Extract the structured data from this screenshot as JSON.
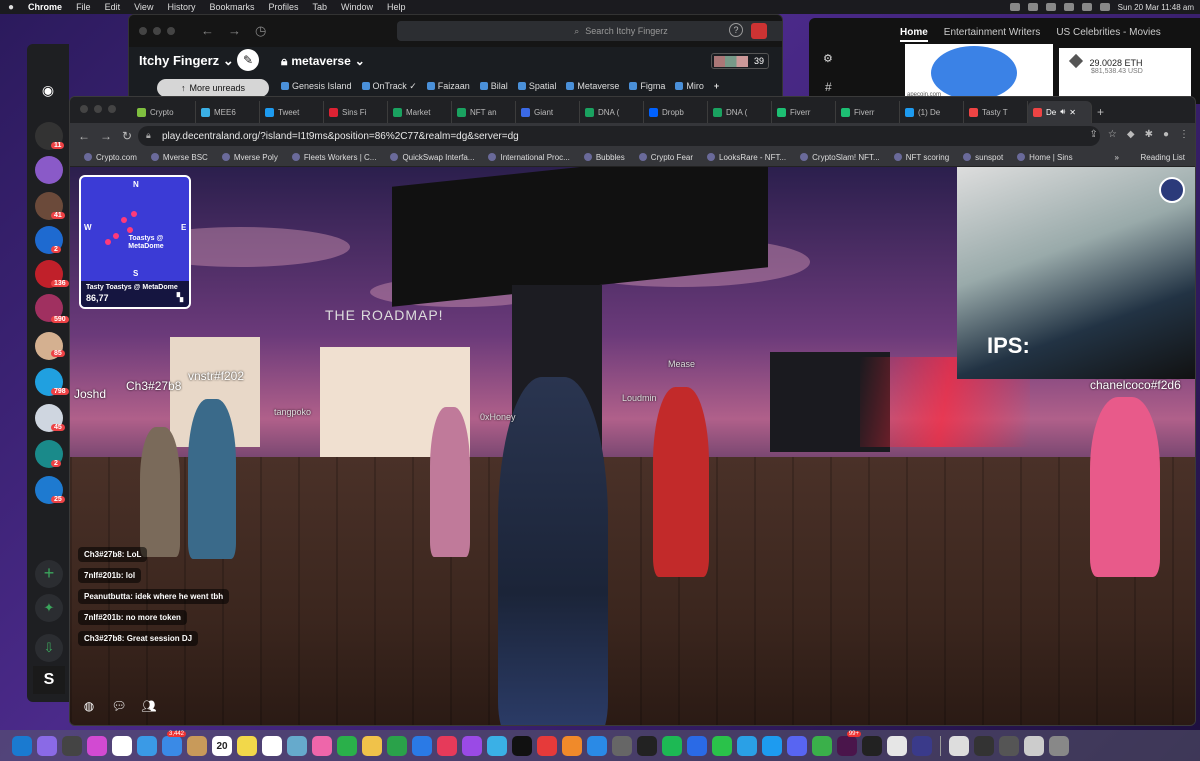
{
  "menubar": {
    "apple": "",
    "app_name": "Chrome",
    "menus": [
      "File",
      "Edit",
      "View",
      "History",
      "Bookmarks",
      "Profiles",
      "Tab",
      "Window",
      "Help"
    ],
    "clock": "Sun 20 Mar  11:48 am"
  },
  "slack": {
    "search_placeholder": "Search Itchy Fingerz",
    "help": "?",
    "workspace": "Itchy Fingerz",
    "workspace_chevron": "⌄",
    "more_unreads": "More unreads",
    "channel": "metaverse",
    "channel_suffix": "⌄",
    "member_count": "39",
    "bookmarks": [
      "Genesis Island",
      "OnTrack ✓",
      "Faizaan",
      "Bilal",
      "Spatial",
      "Metaverse",
      "Figma",
      "Miro"
    ],
    "bookmark_add": "+"
  },
  "side_window": {
    "tabs": [
      "Home",
      "Entertainment Writers",
      "US Celebrities - Movies"
    ],
    "site_label": "apecoin.com",
    "eth_amount": "29.0028 ETH",
    "usd_amount": "$81,538.43 USD"
  },
  "discord": {
    "badges": [
      "11",
      "41",
      "2",
      "136",
      "590",
      "85",
      "798",
      "45",
      "2",
      "25"
    ]
  },
  "chrome": {
    "tabs": [
      {
        "label": "Crypto",
        "color": "#7fbf3f"
      },
      {
        "label": "MEE6",
        "color": "#3bb0e6"
      },
      {
        "label": "Tweet",
        "color": "#1d9bf0"
      },
      {
        "label": "Sins Fi",
        "color": "#d23"
      },
      {
        "label": "Market",
        "color": "#1aa260"
      },
      {
        "label": "NFT an",
        "color": "#1aa260"
      },
      {
        "label": "Giant",
        "color": "#3b6ae6"
      },
      {
        "label": "DNA (",
        "color": "#1aa260"
      },
      {
        "label": "Dropb",
        "color": "#0061ff"
      },
      {
        "label": "DNA (",
        "color": "#1aa260"
      },
      {
        "label": "Fiverr",
        "color": "#1dbf73"
      },
      {
        "label": "Fiverr",
        "color": "#1dbf73"
      },
      {
        "label": "(1) De",
        "color": "#1d9bf0"
      },
      {
        "label": "Tasty T",
        "color": "#e44"
      },
      {
        "label": "De",
        "color": "#e44"
      }
    ],
    "new_tab": "+",
    "url": "play.decentraland.org/?island=I1t9ms&position=86%2C77&realm=dg&server=dg",
    "bookmarks": [
      "Crypto.com",
      "Mverse BSC",
      "Mverse Poly",
      "Fleets Workers | C...",
      "QuickSwap Interfa...",
      "International Proc...",
      "Bubbles",
      "Crypto Fear",
      "LooksRare - NFT...",
      "CryptoSlam! NFT...",
      "NFT scoring",
      "sunspot",
      "Home | Sins"
    ],
    "bookmarks_more": "»",
    "reading_list": "Reading List"
  },
  "scene": {
    "minimap": {
      "north": "N",
      "south": "S",
      "east": "E",
      "west": "W",
      "pin_label": "Toastys @ MetaDome",
      "place_name": "Tasty Toastys @ MetaDome",
      "coords": "86,77"
    },
    "roadmap_sign": "THE ROADMAP!",
    "nametags": [
      "Joshd",
      "Ch3#27b8",
      "vnstr#f202",
      "tangpoko",
      "0xHoney",
      "Mease",
      "Loudmin",
      "chanelcoco#f2d6"
    ],
    "chat": [
      {
        "user": "Ch3#27b8",
        "text": "LoL"
      },
      {
        "user": "7nlf#201b",
        "text": "lol"
      },
      {
        "user": "Peanutbutta",
        "text": "idek where he went tbh"
      },
      {
        "user": "7nlf#201b",
        "text": "no more token"
      },
      {
        "user": "Ch3#27b8",
        "text": "Great session DJ"
      }
    ],
    "screen_text": "IPS:"
  },
  "dock": {
    "calendar_day": "20",
    "mail_badge": "3,442",
    "slack_badge": "99+"
  }
}
